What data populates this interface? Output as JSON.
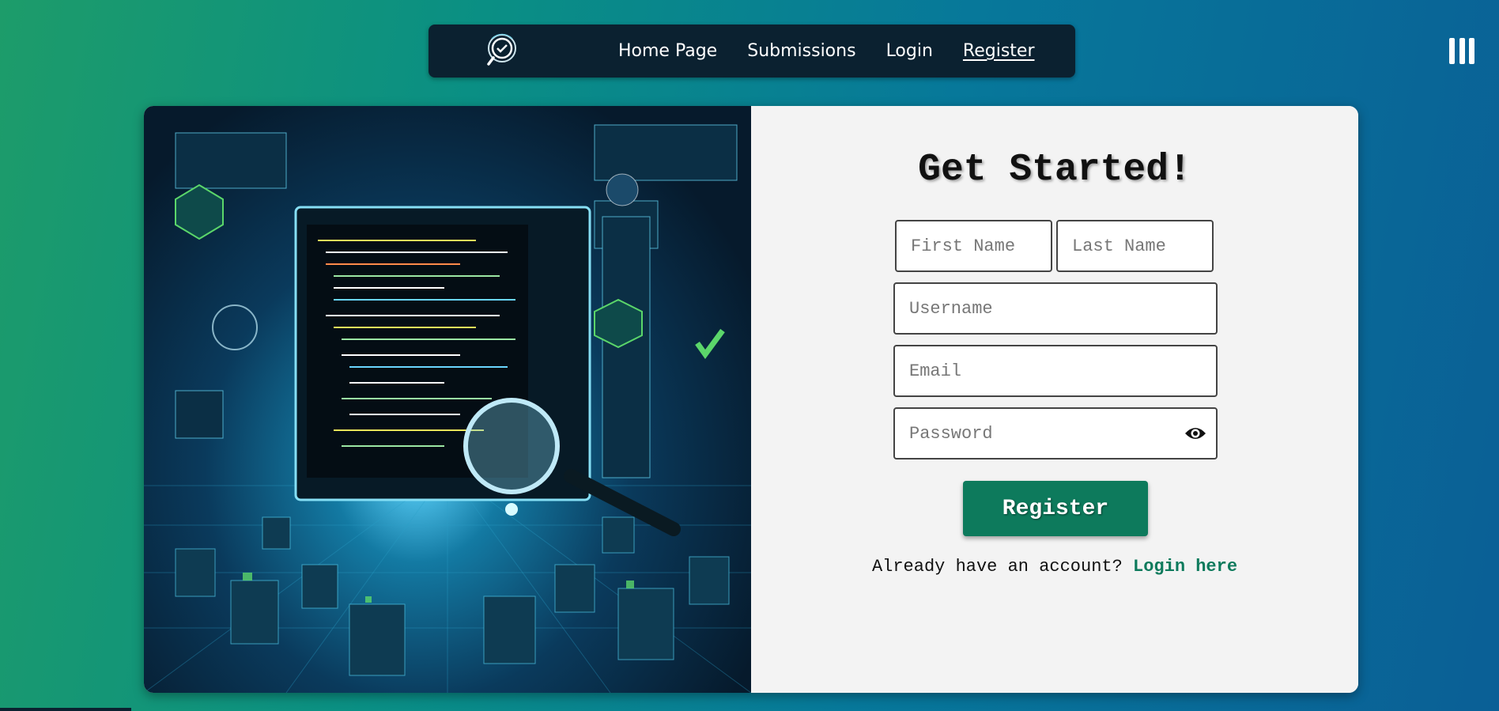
{
  "nav": {
    "logo_icon": "magnifier-check-logo-icon",
    "links": [
      {
        "label": "Home Page"
      },
      {
        "label": "Submissions"
      },
      {
        "label": "Login"
      },
      {
        "label": "Register"
      }
    ],
    "menu_icon": "vertical-bars-menu-icon"
  },
  "card": {
    "illustration_icon": "code-city-magnifier-illustration",
    "heading": "Get Started!",
    "form": {
      "first_name_placeholder": "First Name",
      "last_name_placeholder": "Last Name",
      "username_placeholder": "Username",
      "email_placeholder": "Email",
      "password_placeholder": "Password",
      "password_toggle_icon": "eye-icon",
      "submit_label": "Register"
    },
    "login_prompt": "Already have an account?",
    "login_link": "Login here"
  },
  "colors": {
    "accent": "#0d7a5c",
    "navbar": "#0b2130",
    "panel": "#f3f3f3"
  }
}
